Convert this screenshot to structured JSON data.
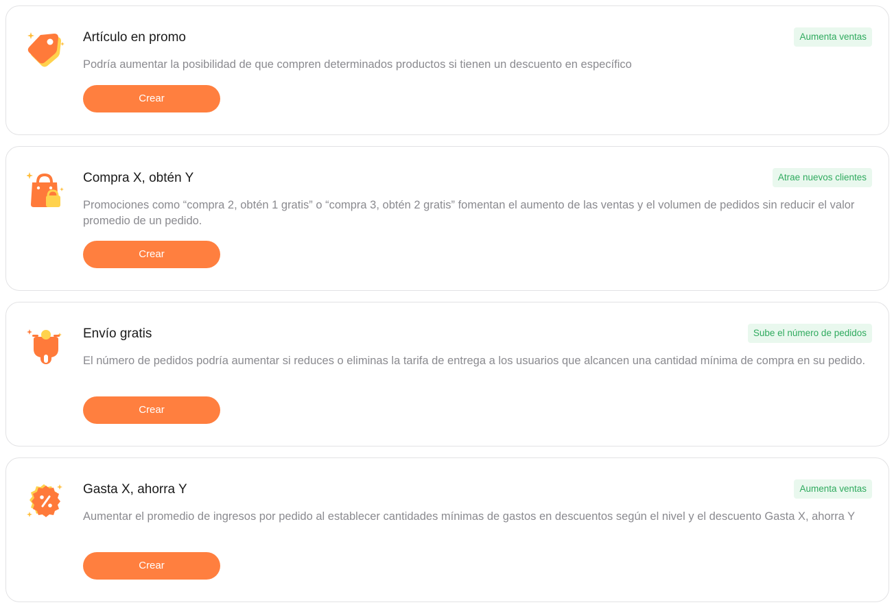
{
  "cards": [
    {
      "title": "Artículo en promo",
      "badge": "Aumenta ventas",
      "description": "Podría aumentar la posibilidad de que compren determinados productos si tienen un descuento en específico",
      "button_label": "Crear",
      "icon": "tag-icon"
    },
    {
      "title": "Compra X, obtén Y",
      "badge": "Atrae nuevos clientes",
      "description": "Promociones como “compra 2, obtén 1 gratis” o “compra 3, obtén 2 gratis” fomentan el aumento de las ventas y el volumen de pedidos sin reducir el valor promedio de un pedido.",
      "button_label": "Crear",
      "icon": "shopping-bag-icon"
    },
    {
      "title": "Envío gratis",
      "badge": "Sube el número de pedidos",
      "description": "El número de pedidos podría aumentar si reduces o eliminas la tarifa de entrega a los usuarios que alcancen una cantidad mínima de compra en su pedido.",
      "button_label": "Crear",
      "icon": "delivery-scooter-icon"
    },
    {
      "title": "Gasta X, ahorra Y",
      "badge": "Aumenta ventas",
      "description": "Aumentar el promedio de ingresos por pedido al establecer cantidades mínimas de gastos en descuentos según el nivel y el descuento Gasta X, ahorra Y",
      "button_label": "Crear",
      "icon": "percent-badge-icon"
    }
  ],
  "colors": {
    "primary_orange": "#ff7f3f",
    "badge_green_text": "#2faa5e",
    "badge_green_bg": "#e9f8ee",
    "accent_yellow": "#ffd24d"
  }
}
